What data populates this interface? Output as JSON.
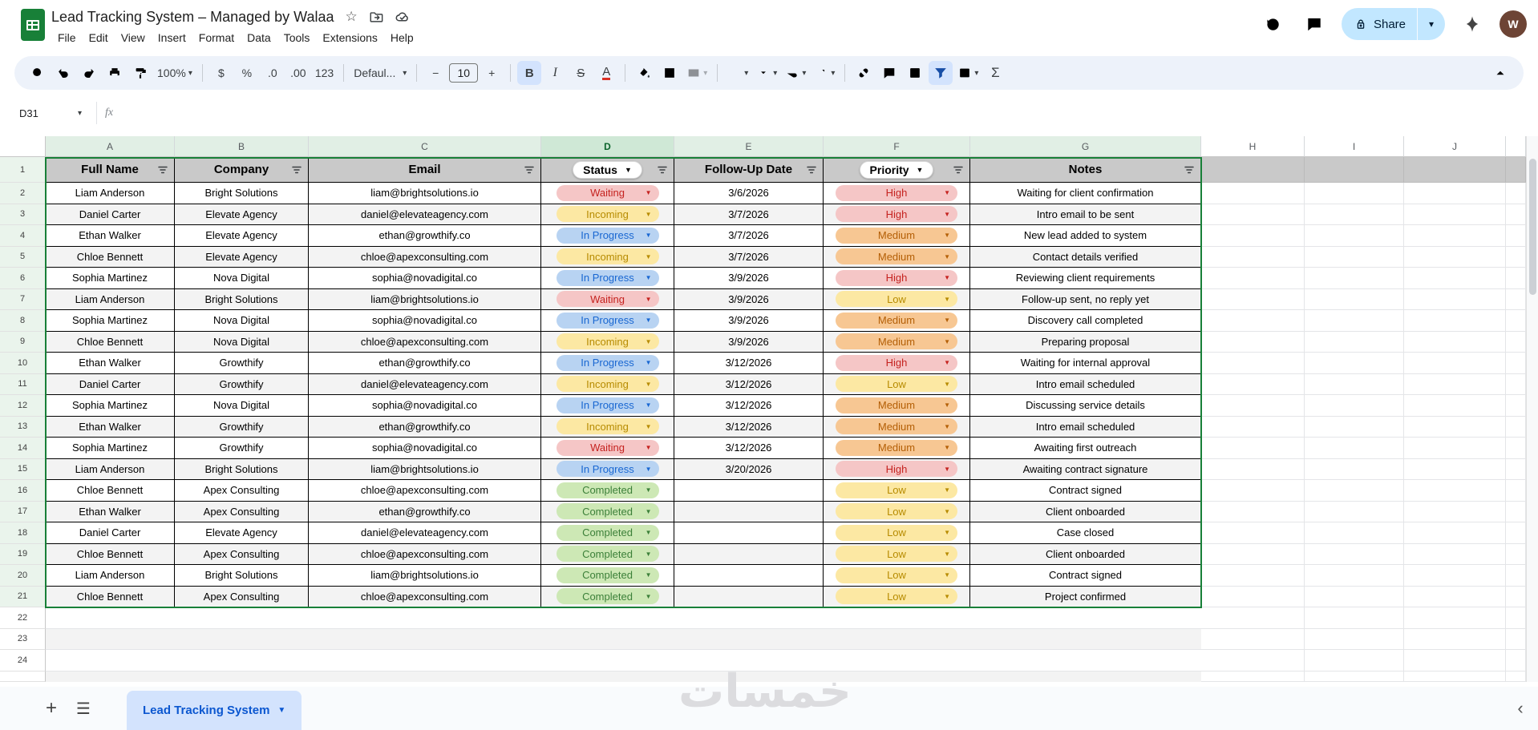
{
  "app": {
    "title": "Lead Tracking System – Managed by Walaa",
    "menu": [
      "File",
      "Edit",
      "View",
      "Insert",
      "Format",
      "Data",
      "Tools",
      "Extensions",
      "Help"
    ],
    "share_label": "Share",
    "avatar_letter": "W"
  },
  "icons": {
    "caret": "▾",
    "chip_arrow": "▼",
    "star": "☆",
    "add": "+",
    "all_sheets": "☰",
    "back": "‹"
  },
  "toolbar": {
    "zoom": "100%",
    "currency": "$",
    "percent": "%",
    "decrease_decimals": ".0",
    "increase_decimals": ".00",
    "more_formats": "123",
    "font_name": "Defaul...",
    "minus": "−",
    "font_size": "10",
    "plus": "+",
    "bold": "B",
    "italic": "I",
    "strikethrough": "S",
    "text_color": "A",
    "functions": "Σ"
  },
  "formula_bar": {
    "name_box": "D31",
    "formula": ""
  },
  "grid": {
    "column_letters": [
      "A",
      "B",
      "C",
      "D",
      "E",
      "F",
      "G",
      "H",
      "I",
      "J"
    ],
    "data_columns": [
      "A",
      "B",
      "C",
      "D",
      "E",
      "F",
      "G"
    ],
    "filtered_columns": 7,
    "selected_column": "D",
    "headers": [
      {
        "label": "Full Name",
        "chip": false
      },
      {
        "label": "Company",
        "chip": false
      },
      {
        "label": "Email",
        "chip": false
      },
      {
        "label": "Status",
        "chip": true
      },
      {
        "label": "Follow-Up Date",
        "chip": false
      },
      {
        "label": "Priority",
        "chip": true
      },
      {
        "label": "Notes",
        "chip": false
      }
    ],
    "rows": [
      {
        "name": "Liam Anderson",
        "company": "Bright Solutions",
        "email": "liam@brightsolutions.io",
        "status": "Waiting",
        "follow_up": "3/6/2026",
        "priority": "High",
        "notes": "Waiting for client confirmation"
      },
      {
        "name": "Daniel Carter",
        "company": "Elevate Agency",
        "email": "daniel@elevateagency.com",
        "status": "Incoming",
        "follow_up": "3/7/2026",
        "priority": "High",
        "notes": "Intro email to be sent"
      },
      {
        "name": "Ethan Walker",
        "company": "Elevate Agency",
        "email": "ethan@growthify.co",
        "status": "In Progress",
        "follow_up": "3/7/2026",
        "priority": "Medium",
        "notes": "New lead added to system"
      },
      {
        "name": "Chloe Bennett",
        "company": "Elevate Agency",
        "email": "chloe@apexconsulting.com",
        "status": "Incoming",
        "follow_up": "3/7/2026",
        "priority": "Medium",
        "notes": "Contact details verified"
      },
      {
        "name": "Sophia Martinez",
        "company": "Nova Digital",
        "email": "sophia@novadigital.co",
        "status": "In Progress",
        "follow_up": "3/9/2026",
        "priority": "High",
        "notes": "Reviewing client requirements"
      },
      {
        "name": "Liam Anderson",
        "company": "Bright Solutions",
        "email": "liam@brightsolutions.io",
        "status": "Waiting",
        "follow_up": "3/9/2026",
        "priority": "Low",
        "notes": "Follow-up sent, no reply yet"
      },
      {
        "name": "Sophia Martinez",
        "company": "Nova Digital",
        "email": "sophia@novadigital.co",
        "status": "In Progress",
        "follow_up": "3/9/2026",
        "priority": "Medium",
        "notes": "Discovery call completed"
      },
      {
        "name": "Chloe Bennett",
        "company": "Nova Digital",
        "email": "chloe@apexconsulting.com",
        "status": "Incoming",
        "follow_up": "3/9/2026",
        "priority": "Medium",
        "notes": "Preparing proposal"
      },
      {
        "name": "Ethan Walker",
        "company": "Growthify",
        "email": "ethan@growthify.co",
        "status": "In Progress",
        "follow_up": "3/12/2026",
        "priority": "High",
        "notes": "Waiting for internal approval"
      },
      {
        "name": "Daniel Carter",
        "company": "Growthify",
        "email": "daniel@elevateagency.com",
        "status": "Incoming",
        "follow_up": "3/12/2026",
        "priority": "Low",
        "notes": "Intro email scheduled"
      },
      {
        "name": "Sophia Martinez",
        "company": "Nova Digital",
        "email": "sophia@novadigital.co",
        "status": "In Progress",
        "follow_up": "3/12/2026",
        "priority": "Medium",
        "notes": "Discussing service details"
      },
      {
        "name": "Ethan Walker",
        "company": "Growthify",
        "email": "ethan@growthify.co",
        "status": "Incoming",
        "follow_up": "3/12/2026",
        "priority": "Medium",
        "notes": "Intro email scheduled"
      },
      {
        "name": "Sophia Martinez",
        "company": "Growthify",
        "email": "sophia@novadigital.co",
        "status": "Waiting",
        "follow_up": "3/12/2026",
        "priority": "Medium",
        "notes": "Awaiting first outreach"
      },
      {
        "name": "Liam Anderson",
        "company": "Bright Solutions",
        "email": "liam@brightsolutions.io",
        "status": "In Progress",
        "follow_up": "3/20/2026",
        "priority": "High",
        "notes": "Awaiting contract signature"
      },
      {
        "name": "Chloe Bennett",
        "company": "Apex Consulting",
        "email": "chloe@apexconsulting.com",
        "status": "Completed",
        "follow_up": "",
        "priority": "Low",
        "notes": "Contract signed"
      },
      {
        "name": "Ethan Walker",
        "company": "Apex Consulting",
        "email": "ethan@growthify.co",
        "status": "Completed",
        "follow_up": "",
        "priority": "Low",
        "notes": "Client onboarded"
      },
      {
        "name": "Daniel Carter",
        "company": "Elevate Agency",
        "email": "daniel@elevateagency.com",
        "status": "Completed",
        "follow_up": "",
        "priority": "Low",
        "notes": "Case closed"
      },
      {
        "name": "Chloe Bennett",
        "company": "Apex Consulting",
        "email": "chloe@apexconsulting.com",
        "status": "Completed",
        "follow_up": "",
        "priority": "Low",
        "notes": "Client onboarded"
      },
      {
        "name": "Liam Anderson",
        "company": "Bright Solutions",
        "email": "liam@brightsolutions.io",
        "status": "Completed",
        "follow_up": "",
        "priority": "Low",
        "notes": "Contract signed"
      },
      {
        "name": "Chloe Bennett",
        "company": "Apex Consulting",
        "email": "chloe@apexconsulting.com",
        "status": "Completed",
        "follow_up": "",
        "priority": "Low",
        "notes": "Project confirmed"
      }
    ],
    "empty_row_numbers": [
      22,
      23,
      24
    ],
    "first_data_row": 2
  },
  "status_colors": {
    "Waiting": {
      "bg": "#f5c6c6",
      "text": "#c5221f"
    },
    "Incoming": {
      "bg": "#fce8a3",
      "text": "#b78b00"
    },
    "In Progress": {
      "bg": "#b8d3f2",
      "text": "#1967d2"
    },
    "Completed": {
      "bg": "#cde8b5",
      "text": "#3c8039"
    }
  },
  "priority_colors": {
    "High": {
      "bg": "#f5c6c6",
      "text": "#c5221f"
    },
    "Medium": {
      "bg": "#f7c793",
      "text": "#b45f06"
    },
    "Low": {
      "bg": "#fce8a3",
      "text": "#b78b00"
    }
  },
  "range_border_color": "#188038",
  "sheet_tab": {
    "label": "Lead Tracking System"
  },
  "watermark": {
    "text": "خمسات"
  }
}
